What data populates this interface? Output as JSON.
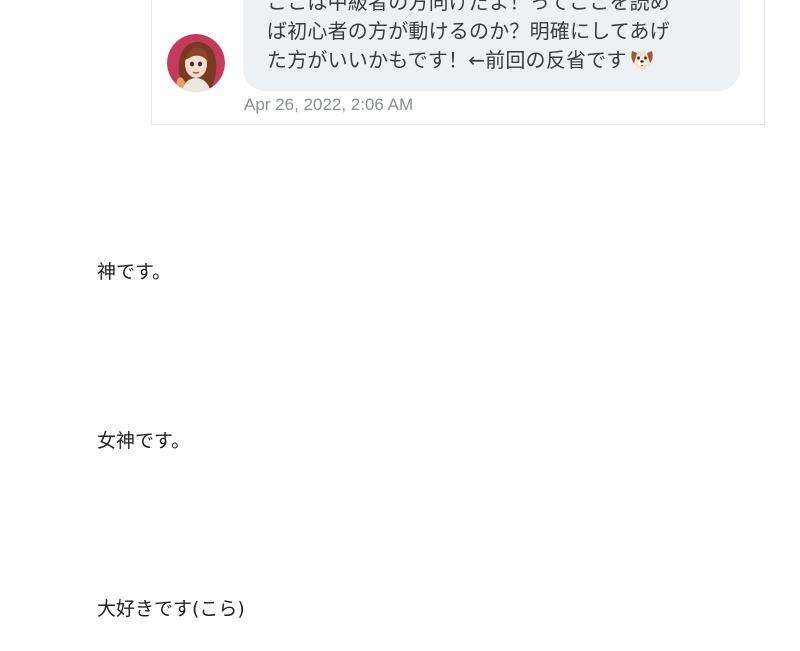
{
  "comment": {
    "text_lines": [
      "ここは中級者の方向けだよ！ってここを読め",
      "ば初心者の方が動けるのか？明確にしてあげ",
      "た方がいいかもです！←前回の反省です"
    ],
    "emoji_icon": "dog-face-icon",
    "timestamp": "Apr 26, 2022, 2:06 AM",
    "avatar_icon": "user-avatar-illustration"
  },
  "article": {
    "lines": [
      "神です。",
      "女神です。",
      "大好きです(こら)"
    ]
  },
  "colors": {
    "bubble_bg": "#eef1f4",
    "timestamp": "#8a8f95",
    "text": "#222222",
    "avatar_bg": "#c43a5a"
  }
}
